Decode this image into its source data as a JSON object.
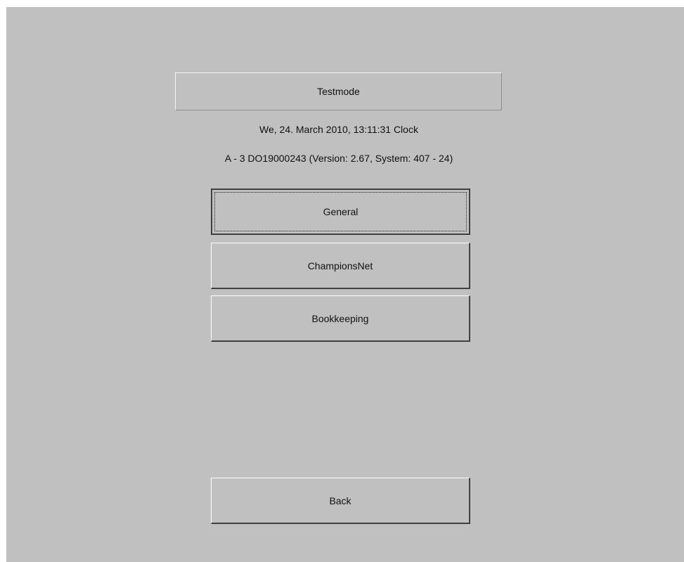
{
  "header": {
    "title": "Testmode"
  },
  "info": {
    "datetime": "We, 24. March 2010, 13:11:31 Clock",
    "device": "A - 3 DO19000243 (Version: 2.67, System: 407 - 24)"
  },
  "menu": {
    "items": [
      {
        "label": "General",
        "focused": true
      },
      {
        "label": "ChampionsNet",
        "focused": false
      },
      {
        "label": "Bookkeeping",
        "focused": false
      }
    ]
  },
  "footer": {
    "back_label": "Back"
  },
  "colors": {
    "background": "#c0c0c0",
    "text": "#111111"
  }
}
